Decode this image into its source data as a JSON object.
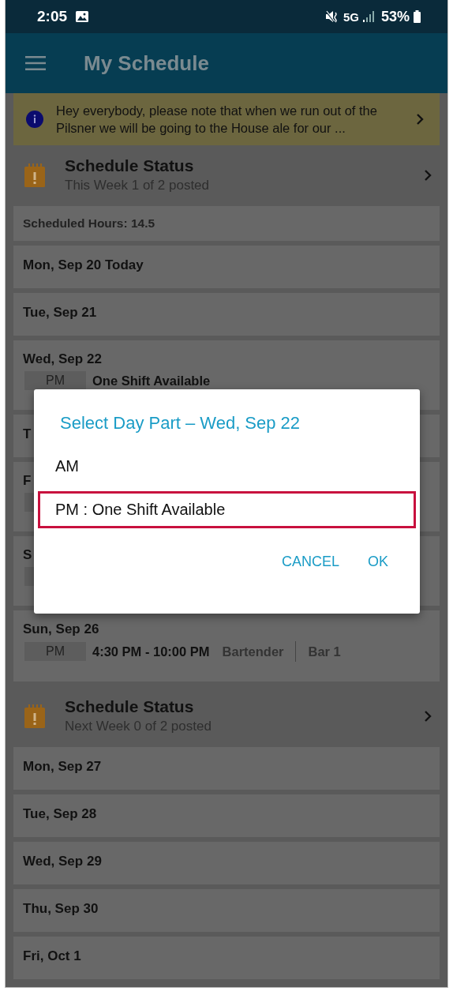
{
  "status_bar": {
    "time": "2:05",
    "network": "5G",
    "battery": "53%"
  },
  "app_bar": {
    "title": "My Schedule"
  },
  "notice": {
    "text": "Hey everybody, please note that when we run out of the Pilsner we will be going to the House ale for our ..."
  },
  "sections": [
    {
      "status": {
        "title": "Schedule Status",
        "subtitle": "This Week 1 of 2 posted"
      },
      "scheduled_hours": "Scheduled Hours: 14.5",
      "days": [
        {
          "label": "Mon, Sep 20 Today"
        },
        {
          "label": "Tue, Sep 21"
        },
        {
          "label": "Wed, Sep 22",
          "shifts": [
            {
              "kind": "open",
              "part": "PM",
              "text": "One Shift Available"
            }
          ]
        },
        {
          "label": "T"
        },
        {
          "label": "F",
          "shifts": [
            {
              "kind": "covered"
            }
          ]
        },
        {
          "label": "S",
          "shifts": [
            {
              "kind": "covered"
            }
          ]
        },
        {
          "label": "Sun, Sep 26",
          "shifts": [
            {
              "kind": "assigned",
              "part": "PM",
              "time": "4:30 PM - 10:00 PM",
              "role": "Bartender",
              "location": "Bar 1"
            }
          ]
        }
      ]
    },
    {
      "status": {
        "title": "Schedule Status",
        "subtitle": "Next Week 0 of 2 posted"
      },
      "days": [
        {
          "label": "Mon, Sep 27"
        },
        {
          "label": "Tue, Sep 28"
        },
        {
          "label": "Wed, Sep 29"
        },
        {
          "label": "Thu, Sep 30"
        },
        {
          "label": "Fri, Oct 1"
        }
      ]
    }
  ],
  "dialog": {
    "title": "Select Day Part – Wed, Sep 22",
    "options": [
      {
        "label": "AM",
        "highlighted": false
      },
      {
        "label": "PM : One Shift Available",
        "highlighted": true
      }
    ],
    "buttons": [
      "CANCEL",
      "OK"
    ]
  }
}
